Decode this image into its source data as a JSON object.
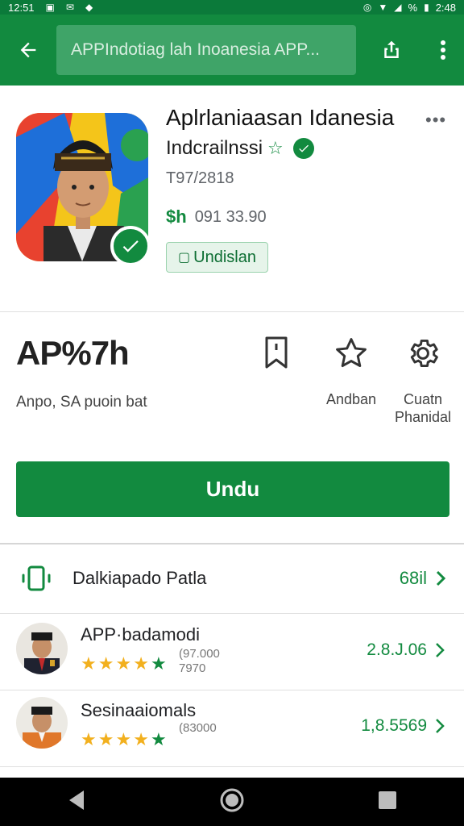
{
  "status_bar": {
    "time": "12:51",
    "battery": "%",
    "clock_right": "2:48"
  },
  "app_bar": {
    "search_text": "APPIndotiag lah Inoanesia  APP..."
  },
  "app": {
    "title": "Aplrlaniaasan Idanesia",
    "developer": "Indcrailnssi",
    "meta_line": "T97/2818",
    "price_currency": "$h",
    "price_value": "091 33.90",
    "install_tag": "Undislan"
  },
  "info": {
    "logo_text": "AP%7h",
    "description": "Anpo, SA puoin bat",
    "buttons": [
      {
        "label": "",
        "icon": "bookmark-icon"
      },
      {
        "label": "Andban",
        "icon": "star-outline-icon"
      },
      {
        "label": "Cuatn Phanidal",
        "icon": "gear-icon"
      }
    ]
  },
  "install_button": {
    "label": "Undu"
  },
  "device_row": {
    "label": "Dalkiapado Patla",
    "value": "68il"
  },
  "reviews": [
    {
      "name": "APP·badamodi",
      "sub1": "(97.000",
      "sub2": "7970",
      "value": "2.8.J.06",
      "stars": 5
    },
    {
      "name": "Sesinaaiomals",
      "sub1": "(83000",
      "sub2": "",
      "value": "1,8.5569",
      "stars": 5
    }
  ],
  "colors": {
    "primary_green": "#128a3f",
    "appbar_green": "#128a3f",
    "star_yellow": "#f2b01e"
  }
}
